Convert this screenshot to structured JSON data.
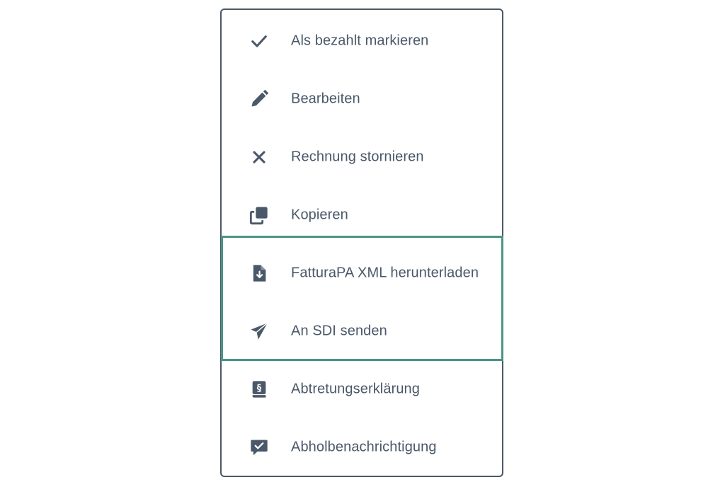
{
  "menu": {
    "items": [
      {
        "label": "Als bezahlt markieren",
        "icon": "check-icon"
      },
      {
        "label": "Bearbeiten",
        "icon": "pencil-icon"
      },
      {
        "label": "Rechnung stornieren",
        "icon": "close-icon"
      },
      {
        "label": "Kopieren",
        "icon": "copy-icon"
      },
      {
        "label": "FatturaPA XML herunterladen",
        "icon": "file-download-icon"
      },
      {
        "label": "An SDI senden",
        "icon": "paper-plane-icon"
      },
      {
        "label": "Abtretungserklärung",
        "icon": "paragraph-book-icon"
      },
      {
        "label": "Abholbenachrichtigung",
        "icon": "message-check-icon"
      }
    ]
  },
  "colors": {
    "text": "#4a5869",
    "border": "#4a5869",
    "highlight": "#4a9484",
    "background": "#ffffff"
  }
}
